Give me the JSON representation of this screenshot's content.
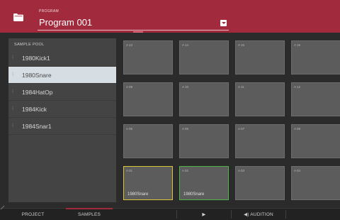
{
  "header": {
    "caption": "PROGRAM",
    "program_name": "Program 001",
    "accent_color": "#a12a3d"
  },
  "sample_pool": {
    "title": "SAMPLE POOL",
    "items": [
      {
        "label": "1980Kick1",
        "selected": false
      },
      {
        "label": "1980Snare",
        "selected": true
      },
      {
        "label": "1984HatOp",
        "selected": false
      },
      {
        "label": "1984Kick",
        "selected": false
      },
      {
        "label": "1984Snar1",
        "selected": false
      }
    ]
  },
  "pads": {
    "rows": [
      [
        {
          "id": "A 13",
          "sample": ""
        },
        {
          "id": "A 14",
          "sample": ""
        },
        {
          "id": "A 15",
          "sample": ""
        },
        {
          "id": "A 16",
          "sample": ""
        }
      ],
      [
        {
          "id": "A 09",
          "sample": ""
        },
        {
          "id": "A 10",
          "sample": ""
        },
        {
          "id": "A 11",
          "sample": ""
        },
        {
          "id": "A 12",
          "sample": ""
        }
      ],
      [
        {
          "id": "A 05",
          "sample": ""
        },
        {
          "id": "A 06",
          "sample": ""
        },
        {
          "id": "A 07",
          "sample": ""
        },
        {
          "id": "A 08",
          "sample": ""
        }
      ],
      [
        {
          "id": "A 01",
          "sample": "1980Snare",
          "state": "yellow"
        },
        {
          "id": "A 02",
          "sample": "1980Snare",
          "state": "green"
        },
        {
          "id": "A 03",
          "sample": ""
        },
        {
          "id": "A 04",
          "sample": ""
        }
      ]
    ]
  },
  "bottom_bar": {
    "project_label": "PROJECT",
    "samples_label": "SAMPLES",
    "play_label": "▶",
    "audition_label": "◀) AUDITION"
  }
}
